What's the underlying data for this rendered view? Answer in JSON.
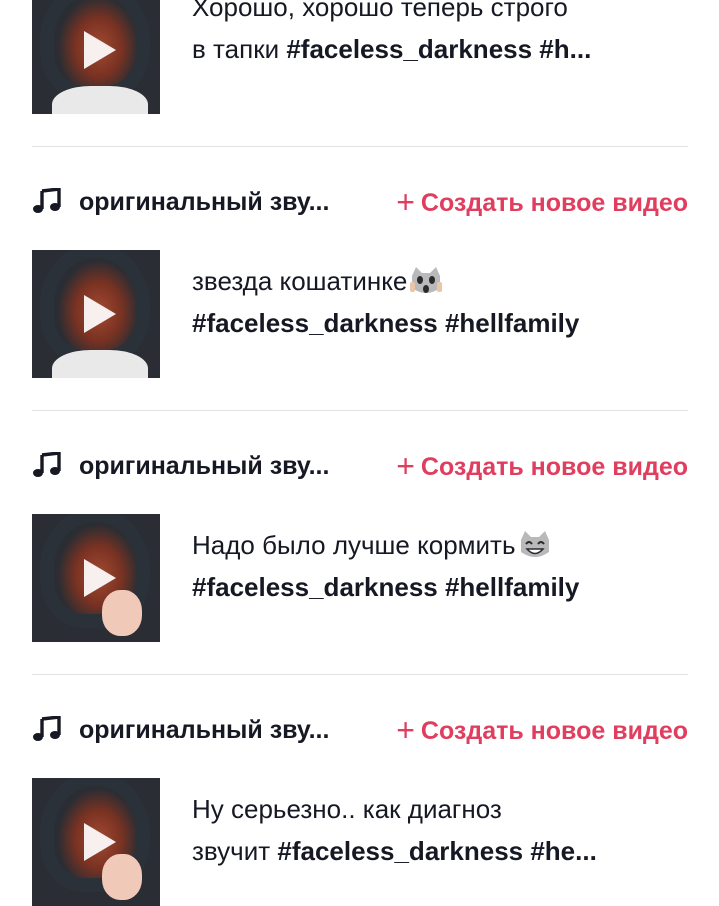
{
  "posts": [
    {
      "line1": "Хорошо, хорошо теперь строго",
      "line2_prefix": "в тапки ",
      "line2_tags": "#faceless_darkness #h..."
    },
    {
      "line1": "звезда кошатинке",
      "line1_emoji": "scream-cat-emoji",
      "line2_prefix": "",
      "line2_tags": "#faceless_darkness #hellfamily"
    },
    {
      "line1": "Надо было лучше кормить",
      "line1_emoji": "grinning-cat-emoji",
      "line2_prefix": "",
      "line2_tags": "#faceless_darkness #hellfamily"
    },
    {
      "line1": "Ну серьезно.. как диагноз",
      "line2_prefix": "звучит ",
      "line2_tags": "#faceless_darkness #he..."
    }
  ],
  "sounds": [
    {
      "name": "оригинальный зву...",
      "create_label": "Создать новое видео"
    },
    {
      "name": "оригинальный зву...",
      "create_label": "Создать новое видео"
    },
    {
      "name": "оригинальный зву...",
      "create_label": "Создать новое видео"
    }
  ],
  "icons": {
    "sound": "music-note-icon",
    "create": "plus-icon",
    "play": "play-icon"
  },
  "colors": {
    "accent": "#e03d5f",
    "text": "#161823",
    "divider": "#e3e3e4"
  }
}
